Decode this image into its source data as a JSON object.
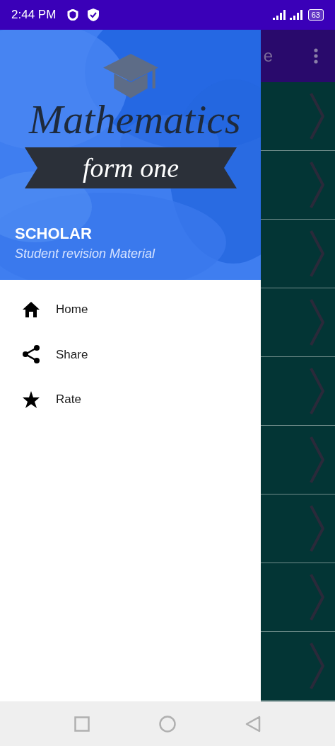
{
  "status_bar": {
    "time": "2:44 PM",
    "battery": "63"
  },
  "app_bar": {
    "title_fragment": "e"
  },
  "rows": [
    {
      "kind": "chevron"
    },
    {
      "kind": "chevron"
    },
    {
      "kind": "chevron"
    },
    {
      "kind": "chevron"
    },
    {
      "kind": "chevron"
    },
    {
      "kind": "chevron"
    },
    {
      "kind": "chevron"
    },
    {
      "kind": "chevron"
    },
    {
      "kind": "chevron"
    }
  ],
  "drawer": {
    "header": {
      "logo_title": "Mathematics",
      "logo_subtitle": "form one",
      "title": "SCHOLAR",
      "subtitle": "Student revision Material"
    },
    "items": [
      {
        "kind": "home",
        "label": "Home"
      },
      {
        "kind": "share",
        "label": "Share"
      },
      {
        "kind": "star",
        "label": "Rate"
      }
    ]
  }
}
